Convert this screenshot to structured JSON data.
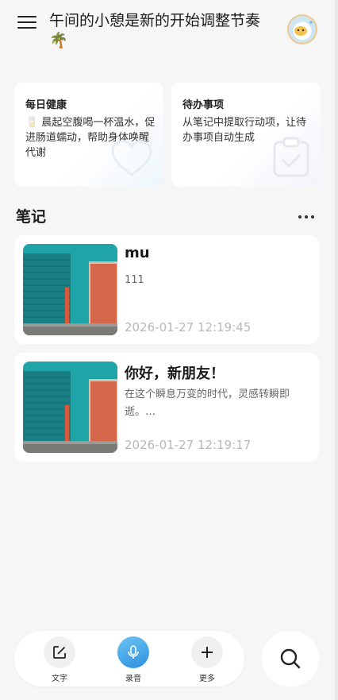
{
  "header": {
    "greeting": "午间的小憩是新的开始调整节奏🌴"
  },
  "cards": {
    "health": {
      "title": "每日健康",
      "body": "🥛 晨起空腹喝一杯温水，促进肠道蠕动，帮助身体唤醒代谢"
    },
    "todo": {
      "title": "待办事项",
      "body": "从笔记中提取行动项，让待办事项自动生成"
    }
  },
  "notes_section": {
    "title": "笔记",
    "items": [
      {
        "title": "mu",
        "body": "111",
        "date": "2026-01-27 12:19:45"
      },
      {
        "title": "你好，新朋友！",
        "body": "在这个瞬息万变的时代，灵感转瞬即逝。…",
        "date": "2026-01-27 12:19:17"
      }
    ]
  },
  "bottom_bar": {
    "text_label": "文字",
    "record_label": "录音",
    "more_label": "更多"
  },
  "colors": {
    "background": "#f6f6f7",
    "accent": "#2e8fe0",
    "date_text": "#b8b8b8"
  }
}
